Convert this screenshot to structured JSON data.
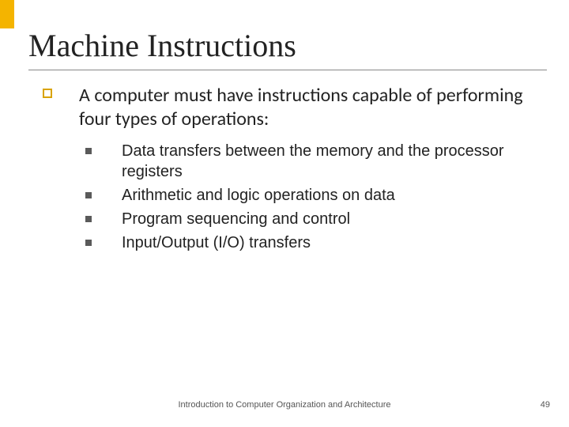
{
  "title": "Machine Instructions",
  "intro": "A computer must have instructions capable of performing four types of operations:",
  "sub_items": [
    "Data transfers between the memory and the processor registers",
    "Arithmetic and logic operations on data",
    "Program sequencing and control",
    "Input/Output (I/O) transfers"
  ],
  "footer": "Introduction to Computer Organization and Architecture",
  "page": "49"
}
